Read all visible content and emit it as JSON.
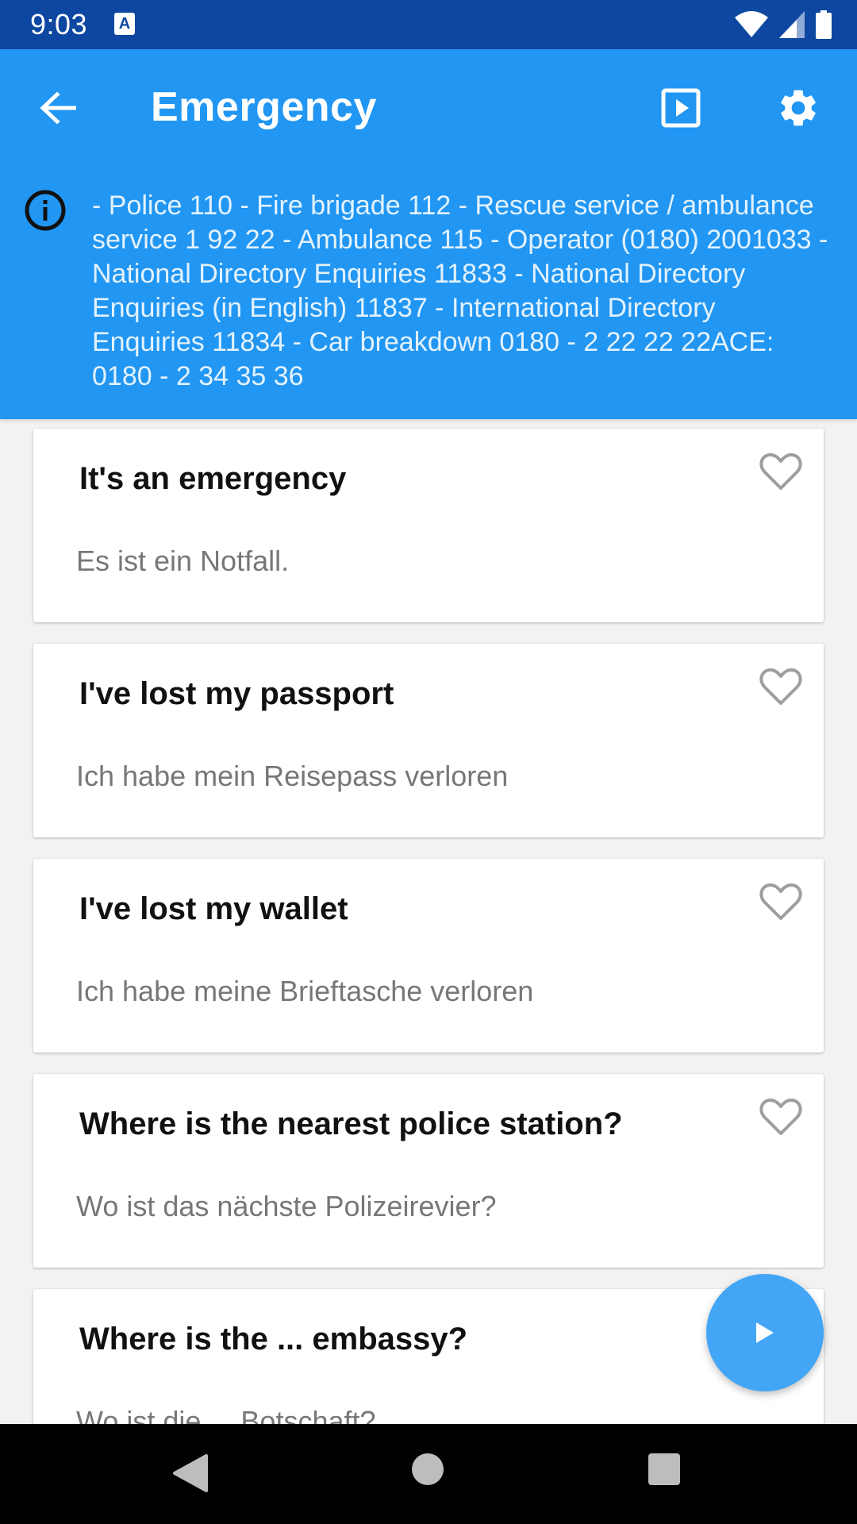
{
  "status_bar": {
    "time": "9:03",
    "notification_badge": "A",
    "icons": [
      "wifi-icon",
      "signal-icon",
      "battery-icon"
    ]
  },
  "app_bar": {
    "title": "Emergency",
    "back_icon": "arrow-left-icon",
    "actions": [
      "slideshow-icon",
      "gear-icon"
    ]
  },
  "info": {
    "icon": "info-circle-icon",
    "text": "- Police 110 - Fire brigade 112 - Rescue service / ambulance service 1 92 22 - Ambulance 115 - Operator (0180) 2001033 - National Directory Enquiries 11833 - National Directory Enquiries (in English) 11837 - International Directory Enquiries 11834 - Car breakdown 0180 - 2 22 22 22ACE: 0180 - 2 34 35 36"
  },
  "phrases": [
    {
      "english": "It's an emergency",
      "german": "Es ist ein Notfall."
    },
    {
      "english": "I've lost my passport",
      "german": "Ich habe mein Reisepass verloren"
    },
    {
      "english": "I've lost my wallet",
      "german": "Ich habe meine Brieftasche verloren"
    },
    {
      "english": "Where is the nearest police station?",
      "german": "Wo ist das nächste Polizeirevier?"
    },
    {
      "english": "Where is the ... embassy?",
      "german": "Wo ist die ... Botschaft?"
    }
  ],
  "colors": {
    "status_bar": "#0d47a1",
    "app_bar": "#2196f3",
    "fab": "#42a5f5",
    "heart": "#9e9e9e"
  }
}
